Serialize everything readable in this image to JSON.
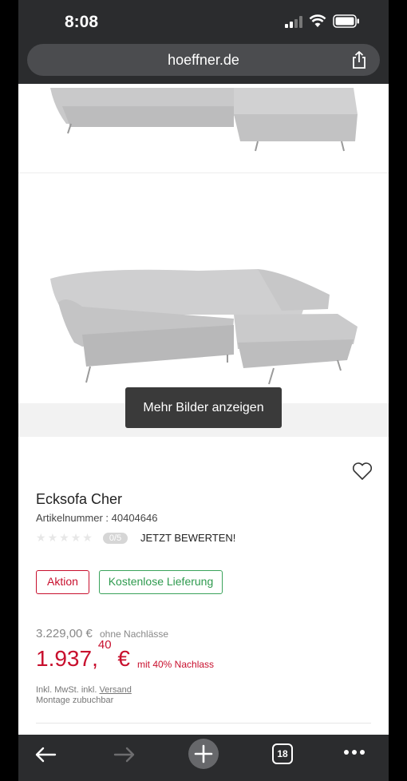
{
  "status": {
    "time": "8:08"
  },
  "browser": {
    "url": "hoeffner.de",
    "tab_count": "18"
  },
  "gallery": {
    "more_images_label": "Mehr Bilder anzeigen"
  },
  "product": {
    "title": "Ecksofa Cher",
    "article_number": "Artikelnummer : 40404646",
    "rating_badge": "0/5",
    "rate_link": "JETZT BEWERTEN!",
    "badges": {
      "action": "Aktion",
      "free_delivery": "Kostenlose Lieferung"
    },
    "price": {
      "old": "3.229,00 €",
      "old_note": "ohne Nachlässe",
      "current_main": "1.937,",
      "current_cents": "40",
      "currency": " €",
      "discount_note": "mit 40% Nachlass"
    },
    "vat_prefix": "Inkl. MwSt. inkl.",
    "vat_link": "Versand",
    "assembly_note": "Montage zubuchbar"
  },
  "colors": {
    "accent_red": "#c8102e",
    "accent_green": "#3aa35b",
    "chrome": "#2b2c2e"
  }
}
